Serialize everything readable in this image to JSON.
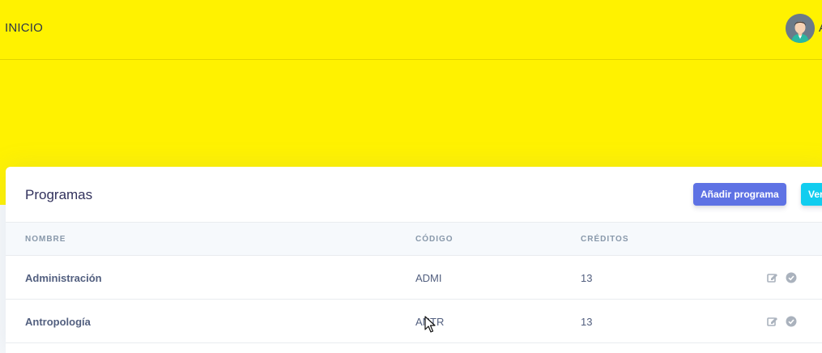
{
  "header": {
    "title": "INICIO",
    "user_initial": "A"
  },
  "card": {
    "title": "Programas",
    "add_button": "Añadir programa",
    "view_button": "Ver"
  },
  "table": {
    "columns": [
      "NOMBRE",
      "CÓDIGO",
      "CRÉDITOS"
    ],
    "rows": [
      {
        "nombre": "Administración",
        "codigo": "ADMI",
        "creditos": "13"
      },
      {
        "nombre": "Antropología",
        "codigo": "ANTR",
        "creditos": "13"
      }
    ]
  },
  "colors": {
    "header_bg": "#fff200",
    "primary": "#5e72e4",
    "info": "#11cdef"
  },
  "icons": [
    "user-avatar-icon",
    "edit-icon",
    "check-circle-icon",
    "mouse-cursor-icon"
  ]
}
